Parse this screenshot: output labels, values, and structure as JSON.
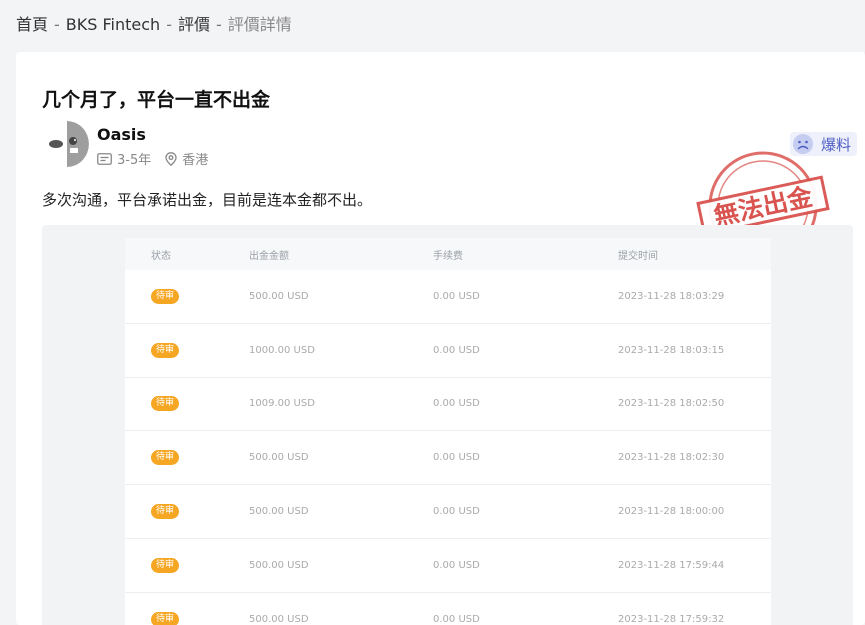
{
  "breadcrumb": {
    "items": [
      "首頁",
      "BKS Fintech",
      "評價"
    ],
    "separator": "-",
    "current": "評價詳情"
  },
  "review": {
    "title": "几个月了，平台一直不出金",
    "author": "Oasis",
    "experience": "3-5年",
    "location": "香港",
    "tag": "爆料",
    "stamp_text": "無法出金",
    "content": "多次沟通，平台承诺出金，目前是连本金都不出。"
  },
  "record_table": {
    "columns": [
      "状态",
      "出金金额",
      "手续费",
      "提交时间"
    ],
    "rows": [
      {
        "status": "待审",
        "amount": "500.00 USD",
        "fee": "0.00 USD",
        "time": "2023-11-28 18:03:29"
      },
      {
        "status": "待审",
        "amount": "1000.00 USD",
        "fee": "0.00 USD",
        "time": "2023-11-28 18:03:15"
      },
      {
        "status": "待审",
        "amount": "1009.00 USD",
        "fee": "0.00 USD",
        "time": "2023-11-28 18:02:50"
      },
      {
        "status": "待审",
        "amount": "500.00 USD",
        "fee": "0.00 USD",
        "time": "2023-11-28 18:02:30"
      },
      {
        "status": "待审",
        "amount": "500.00 USD",
        "fee": "0.00 USD",
        "time": "2023-11-28 18:00:00"
      },
      {
        "status": "待审",
        "amount": "500.00 USD",
        "fee": "0.00 USD",
        "time": "2023-11-28 17:59:44"
      },
      {
        "status": "待审",
        "amount": "500.00 USD",
        "fee": "0.00 USD",
        "time": "2023-11-28 17:59:32"
      }
    ]
  },
  "colors": {
    "accent": "#4f5ec6",
    "stamp": "#d9534f",
    "badge": "#f5a623"
  }
}
